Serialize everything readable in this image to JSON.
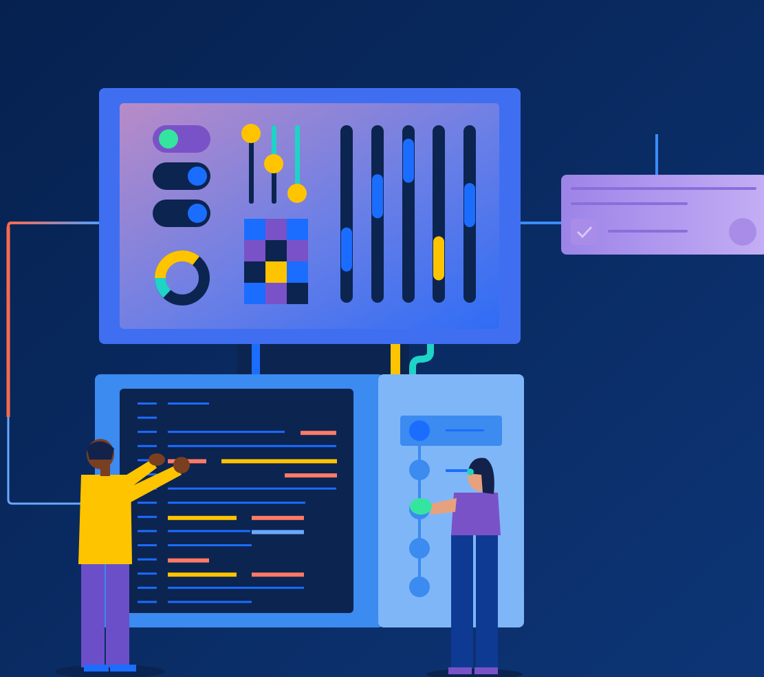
{
  "scene": {
    "description_free": true,
    "colors": {
      "background_top": "#072456",
      "background_bottom": "#0c3270",
      "dashboard_frame": "#3f6ff0",
      "dashboard_panel_start": "#b08ccf",
      "dashboard_panel_end": "#3a6ff2",
      "code_console": "#3b8bf0",
      "code_screen": "#0c2450",
      "side_panel": "#7fb6f8",
      "notification_card": "#b8a1f0",
      "accent_yellow": "#ffc400",
      "accent_teal": "#1fd3c6",
      "accent_blue": "#1b6dff",
      "accent_green": "#34e5a0",
      "accent_coral": "#ff7a66",
      "accent_purple": "#7a52c7"
    },
    "icons": [
      "toggle-switch-icon",
      "slider-icon",
      "donut-chart-icon",
      "pixel-grid-icon",
      "checkbox-icon",
      "avatar-circle-icon"
    ],
    "toggles": [
      {
        "state": "on"
      },
      {
        "state": "off"
      },
      {
        "state": "off"
      }
    ],
    "small_sliders": [
      {
        "level": 0.9
      },
      {
        "level": 0.5
      },
      {
        "level": 0.15
      }
    ],
    "vertical_sliders": [
      {
        "level": 0.3,
        "color": "#1b6dff"
      },
      {
        "level": 0.6,
        "color": "#1b6dff"
      },
      {
        "level": 0.8,
        "color": "#1b6dff"
      },
      {
        "level": 0.25,
        "color": "#ffc400"
      },
      {
        "level": 0.55,
        "color": "#1b6dff"
      }
    ]
  }
}
